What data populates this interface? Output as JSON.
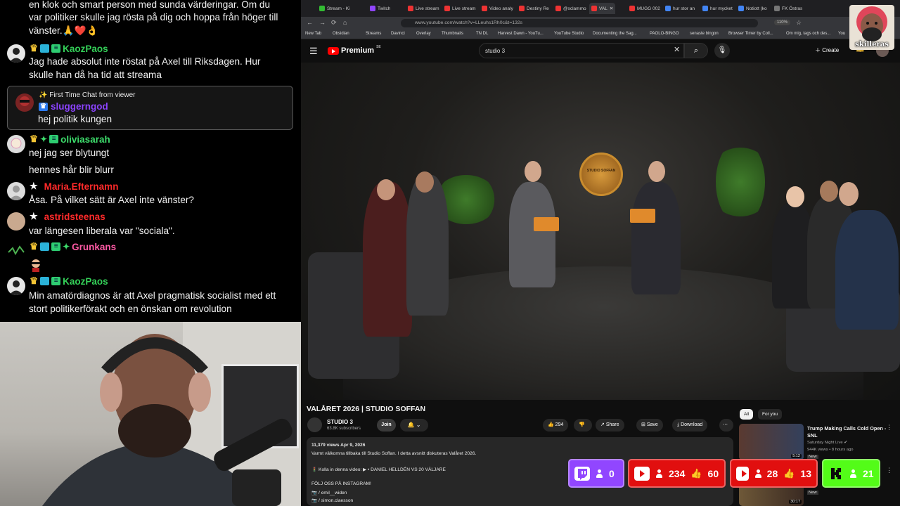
{
  "chat": {
    "messages": [
      {
        "user": "",
        "lines": [
          "en klok och smart person med sunda värderingar. Om du",
          "var politiker skulle jag rösta på dig och hoppa från höger till",
          "vänster.🙏❤️👌"
        ]
      },
      {
        "user": "KaozPaos",
        "color": "#34d058",
        "lines": [
          "Jag hade absolut inte röstat på Axel till Riksdagen. Hur",
          "skulle han då ha tid att streama"
        ]
      },
      {
        "user": "oliviasarah",
        "color": "#3ddc6b",
        "lines": [
          "nej jag ser blytungt",
          "hennes hår blir blurr"
        ]
      },
      {
        "user": "Maria.Efternamn",
        "color": "#ff2a2a",
        "lines": [
          "Åsa. På vilket sätt är Axel inte vänster?"
        ]
      },
      {
        "user": "astridsteenas",
        "color": "#ff2a2a",
        "lines": [
          "var längesen liberala var \"sociala\"."
        ]
      },
      {
        "user": "Grunkans",
        "color": "#ff5aa5",
        "lines": [
          ""
        ]
      },
      {
        "user": "KaozPaos",
        "color": "#34d058",
        "lines": [
          "Min amatördiagnos är att Axel pragmatisk socialist med ett",
          "stort politikerförakt och en önskan om revolution"
        ]
      }
    ],
    "first_time": {
      "header": "✨ First Time Chat from viewer",
      "user": "sluggerngod",
      "text": "hej politik kungen"
    }
  },
  "browser": {
    "tabs": [
      "Stream - Ki",
      "Twitch",
      "Live stream",
      "Live stream",
      "Video analy",
      "Destiny Re",
      "@sclammo",
      "VAL",
      "MUGG 002",
      "hur stor an",
      "hur mycket",
      "Notiott (ko",
      "FK Östras"
    ],
    "url": "www.youtube.com/watch?v=LLeuhs1Rh0c&t=132s",
    "zoom": "110%",
    "bookmarks": [
      "New Tab",
      "Obsidian",
      "Streams",
      "Davinci",
      "Overlay",
      "Thumbnails",
      "TN DL",
      "Harvest Dawn - YouTu...",
      "YouTube Studio",
      "Documenting the Sag...",
      "PAOLO-BINGO",
      "senaste bingon",
      "Browser Timer by Coll...",
      "Om mig, tags och des...",
      "You"
    ]
  },
  "youtube": {
    "logo_text": "Premium",
    "logo_region": "SE",
    "search_value": "studio 3",
    "create_label": "Create",
    "video_title": "VALÅRET 2026 | STUDIO SOFFAN",
    "studio_sign": "STUDIO SOFFAN",
    "channel_name": "STUDIO 3",
    "subscribers": "63.8K subscribers",
    "join_label": "Join",
    "likes": "294",
    "share_label": "Share",
    "save_label": "Save",
    "download_label": "Download",
    "description": {
      "meta": "11,379 views  Apr 9, 2026",
      "line1": "Varmt välkomna tillbaka till Studio Soffan. I detta avsnitt diskuteras Valåret 2026.",
      "line2": "🚦 Kolla in denna video:  ▶ • DANIEL HELLDÉN VS 20 VÄLJARE",
      "line3": "FÖLJ OSS PÅ INSTAGRAM!",
      "line4": "📷 / emil__widen",
      "line5": "📷 / simon.claesson"
    },
    "chips": [
      "All",
      "For you"
    ],
    "recommendations": [
      {
        "title": "Trump Making Calls Cold Open - SNL",
        "channel": "Saturday Night Live ✔",
        "meta": "944K views • 8 hours ago",
        "badge": "New",
        "duration": "5:12"
      },
      {
        "title": "",
        "channel": "",
        "meta": "",
        "badge": "New",
        "duration": "30:17"
      }
    ]
  },
  "overlay": {
    "logo_text": "skilleras",
    "stats": [
      {
        "platform": "twitch",
        "viewers": "0"
      },
      {
        "platform": "youtube",
        "viewers": "234",
        "likes": "60"
      },
      {
        "platform": "youtube",
        "viewers": "28",
        "likes": "13"
      },
      {
        "platform": "kick",
        "viewers": "21"
      }
    ]
  }
}
